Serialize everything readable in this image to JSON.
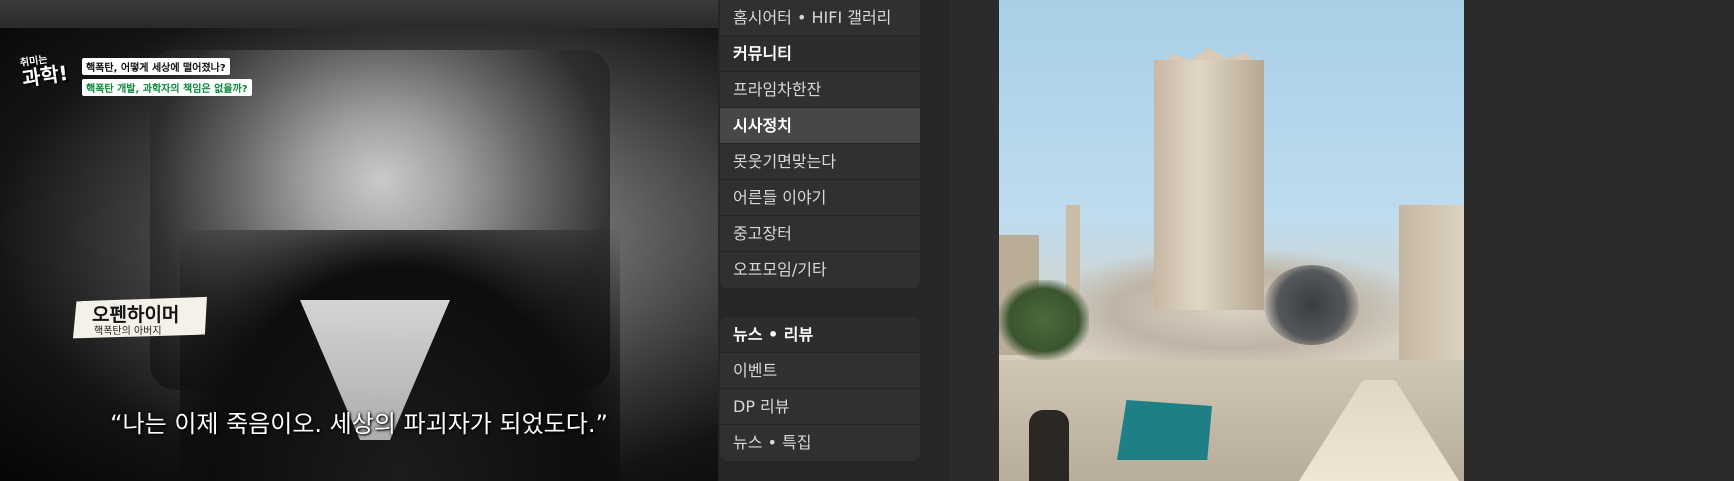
{
  "video_left": {
    "logo_small": "취미는",
    "logo_big": "과학!",
    "tag_1": "핵폭탄, 어떻게 세상에 떨어졌나?",
    "tag_2": "핵폭탄 개발, 과학자의 책임은 없을까?",
    "name": "오펜하이머",
    "name_sub": "핵폭탄의 아버지",
    "subtitle": "“나는 이제 죽음이오. 세상의 파괴자가 되었도다.”"
  },
  "menu": {
    "group1": [
      {
        "label": "홈시어터 • HIFI 갤러리",
        "type": "item"
      },
      {
        "label": "커뮤니티",
        "type": "header"
      },
      {
        "label": "프라임차한잔",
        "type": "item"
      },
      {
        "label": "시사정치",
        "type": "active"
      },
      {
        "label": "못웃기면맞는다",
        "type": "item"
      },
      {
        "label": "어른들 이야기",
        "type": "item"
      },
      {
        "label": "중고장터",
        "type": "item"
      },
      {
        "label": "오프모임/기타",
        "type": "item"
      }
    ],
    "group2": [
      {
        "label": "뉴스 • 리뷰",
        "type": "header"
      },
      {
        "label": "이벤트",
        "type": "item"
      },
      {
        "label": "DP 리뷰",
        "type": "item"
      },
      {
        "label": "뉴스 • 특집",
        "type": "item"
      }
    ]
  }
}
